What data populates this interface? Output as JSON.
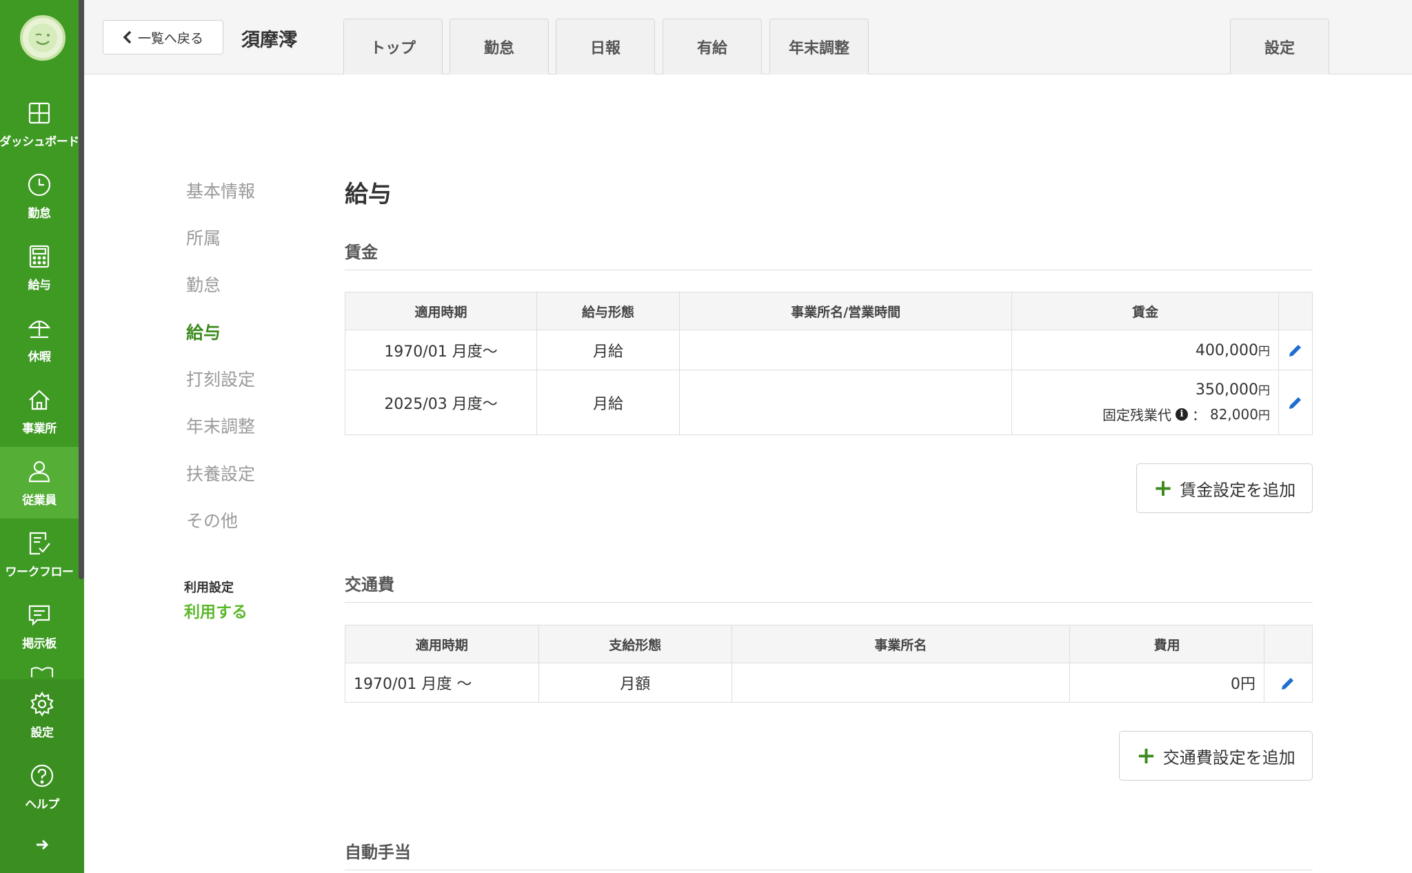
{
  "colors": {
    "sidebar": "#3f9a24",
    "sidebar_active": "#55ae36",
    "accent_green": "#3d8a1e",
    "usage_green": "#5cb82c",
    "edit_blue": "#1e6fd0"
  },
  "sidebar": {
    "items": [
      {
        "label": "ダッシュボード",
        "icon": "dashboard-icon"
      },
      {
        "label": "勤怠",
        "icon": "clock-icon"
      },
      {
        "label": "給与",
        "icon": "calculator-icon"
      },
      {
        "label": "休暇",
        "icon": "beach-umbrella-icon"
      },
      {
        "label": "事業所",
        "icon": "home-icon"
      },
      {
        "label": "従業員",
        "icon": "user-icon",
        "active": true
      },
      {
        "label": "ワークフロー",
        "icon": "workflow-check-icon"
      },
      {
        "label": "掲示板",
        "icon": "chat-icon"
      }
    ],
    "bottom": [
      {
        "label": "設定",
        "icon": "gear-icon"
      },
      {
        "label": "ヘルプ",
        "icon": "help-icon"
      }
    ],
    "collapse_icon": "arrow-right-icon"
  },
  "header": {
    "back_label": "一覧へ戻る",
    "employee_name": "須摩澪",
    "tabs": [
      "トップ",
      "勤怠",
      "日報",
      "有給",
      "年末調整"
    ],
    "settings_tab": "設定"
  },
  "subnav": {
    "items": [
      "基本情報",
      "所属",
      "勤怠",
      "給与",
      "打刻設定",
      "年末調整",
      "扶養設定",
      "その他"
    ],
    "active": "給与",
    "usage_label": "利用設定",
    "usage_value": "利用する"
  },
  "main": {
    "title": "給与",
    "wage": {
      "title": "賃金",
      "headers": [
        "適用時期",
        "給与形態",
        "事業所名/営業時間",
        "賃金"
      ],
      "rows": [
        {
          "period": "1970/01 月度〜",
          "type": "月給",
          "office": "",
          "amount": "400,000",
          "unit": "円"
        },
        {
          "period": "2025/03 月度〜",
          "type": "月給",
          "office": "",
          "amount": "350,000",
          "unit": "円",
          "fixed_overtime_label": "固定残業代",
          "fixed_overtime_sep": "：",
          "fixed_overtime_amount": "82,000",
          "fixed_overtime_unit": "円"
        }
      ],
      "add_label": "賃金設定を追加"
    },
    "transport": {
      "title": "交通費",
      "headers": [
        "適用時期",
        "支給形態",
        "事業所名",
        "費用"
      ],
      "rows": [
        {
          "period": "1970/01 月度 〜",
          "type": "月額",
          "office": "",
          "cost": "0円"
        }
      ],
      "add_label": "交通費設定を追加"
    },
    "auto_allowance": {
      "title": "自動手当"
    }
  }
}
